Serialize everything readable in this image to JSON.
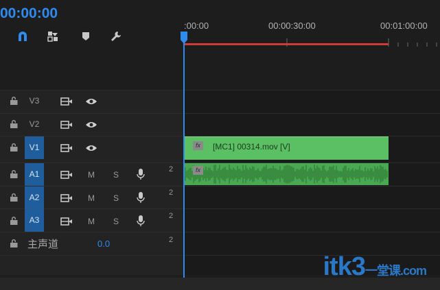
{
  "timecode": "00:00:00",
  "ruler": {
    "labels": [
      ":00:00",
      "00:00:30:00",
      "00:01:00:00"
    ]
  },
  "toolbar": {
    "icons": [
      "magnet-icon",
      "linked-selection-icon",
      "add-marker-icon",
      "wrench-icon"
    ]
  },
  "tracks": {
    "video": [
      {
        "name": "V3",
        "active": false
      },
      {
        "name": "V2",
        "active": false
      },
      {
        "name": "V1",
        "active": true
      }
    ],
    "audio": [
      {
        "name": "A1",
        "active": true,
        "m": "M",
        "s": "S",
        "channels": "2"
      },
      {
        "name": "A2",
        "active": true,
        "m": "M",
        "s": "S",
        "channels": "2"
      },
      {
        "name": "A3",
        "active": true,
        "m": "M",
        "s": "S",
        "channels": "2"
      }
    ],
    "master": {
      "label": "主声道",
      "value": "0.0",
      "channels": "2"
    }
  },
  "clips": {
    "video_name": "[MC1] 00314.mov [V]",
    "fx_label": "fx"
  },
  "watermark": {
    "main": "itk3",
    "sub": "一堂课",
    "dom": ".com"
  },
  "colors": {
    "accent": "#2e8bf0",
    "video_clip": "#5bbf64",
    "audio_clip": "#49a852",
    "ruler_bar": "#d23a3a"
  }
}
